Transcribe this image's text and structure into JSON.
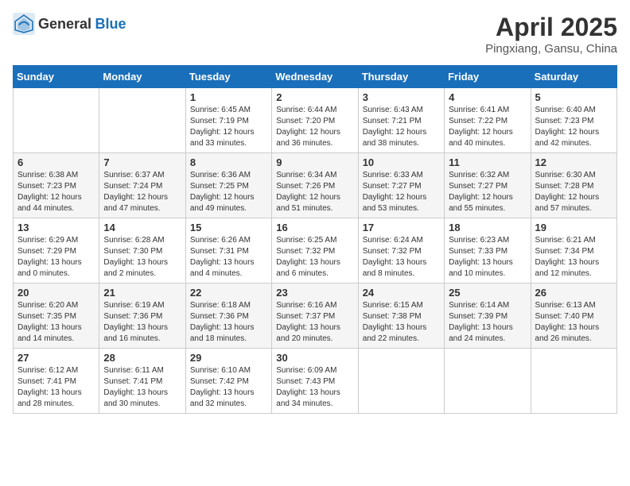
{
  "header": {
    "logo_general": "General",
    "logo_blue": "Blue",
    "month_title": "April 2025",
    "location": "Pingxiang, Gansu, China"
  },
  "days_of_week": [
    "Sunday",
    "Monday",
    "Tuesday",
    "Wednesday",
    "Thursday",
    "Friday",
    "Saturday"
  ],
  "weeks": [
    [
      {
        "day": "",
        "sunrise": "",
        "sunset": "",
        "daylight": ""
      },
      {
        "day": "",
        "sunrise": "",
        "sunset": "",
        "daylight": ""
      },
      {
        "day": "1",
        "sunrise": "Sunrise: 6:45 AM",
        "sunset": "Sunset: 7:19 PM",
        "daylight": "Daylight: 12 hours and 33 minutes."
      },
      {
        "day": "2",
        "sunrise": "Sunrise: 6:44 AM",
        "sunset": "Sunset: 7:20 PM",
        "daylight": "Daylight: 12 hours and 36 minutes."
      },
      {
        "day": "3",
        "sunrise": "Sunrise: 6:43 AM",
        "sunset": "Sunset: 7:21 PM",
        "daylight": "Daylight: 12 hours and 38 minutes."
      },
      {
        "day": "4",
        "sunrise": "Sunrise: 6:41 AM",
        "sunset": "Sunset: 7:22 PM",
        "daylight": "Daylight: 12 hours and 40 minutes."
      },
      {
        "day": "5",
        "sunrise": "Sunrise: 6:40 AM",
        "sunset": "Sunset: 7:23 PM",
        "daylight": "Daylight: 12 hours and 42 minutes."
      }
    ],
    [
      {
        "day": "6",
        "sunrise": "Sunrise: 6:38 AM",
        "sunset": "Sunset: 7:23 PM",
        "daylight": "Daylight: 12 hours and 44 minutes."
      },
      {
        "day": "7",
        "sunrise": "Sunrise: 6:37 AM",
        "sunset": "Sunset: 7:24 PM",
        "daylight": "Daylight: 12 hours and 47 minutes."
      },
      {
        "day": "8",
        "sunrise": "Sunrise: 6:36 AM",
        "sunset": "Sunset: 7:25 PM",
        "daylight": "Daylight: 12 hours and 49 minutes."
      },
      {
        "day": "9",
        "sunrise": "Sunrise: 6:34 AM",
        "sunset": "Sunset: 7:26 PM",
        "daylight": "Daylight: 12 hours and 51 minutes."
      },
      {
        "day": "10",
        "sunrise": "Sunrise: 6:33 AM",
        "sunset": "Sunset: 7:27 PM",
        "daylight": "Daylight: 12 hours and 53 minutes."
      },
      {
        "day": "11",
        "sunrise": "Sunrise: 6:32 AM",
        "sunset": "Sunset: 7:27 PM",
        "daylight": "Daylight: 12 hours and 55 minutes."
      },
      {
        "day": "12",
        "sunrise": "Sunrise: 6:30 AM",
        "sunset": "Sunset: 7:28 PM",
        "daylight": "Daylight: 12 hours and 57 minutes."
      }
    ],
    [
      {
        "day": "13",
        "sunrise": "Sunrise: 6:29 AM",
        "sunset": "Sunset: 7:29 PM",
        "daylight": "Daylight: 13 hours and 0 minutes."
      },
      {
        "day": "14",
        "sunrise": "Sunrise: 6:28 AM",
        "sunset": "Sunset: 7:30 PM",
        "daylight": "Daylight: 13 hours and 2 minutes."
      },
      {
        "day": "15",
        "sunrise": "Sunrise: 6:26 AM",
        "sunset": "Sunset: 7:31 PM",
        "daylight": "Daylight: 13 hours and 4 minutes."
      },
      {
        "day": "16",
        "sunrise": "Sunrise: 6:25 AM",
        "sunset": "Sunset: 7:32 PM",
        "daylight": "Daylight: 13 hours and 6 minutes."
      },
      {
        "day": "17",
        "sunrise": "Sunrise: 6:24 AM",
        "sunset": "Sunset: 7:32 PM",
        "daylight": "Daylight: 13 hours and 8 minutes."
      },
      {
        "day": "18",
        "sunrise": "Sunrise: 6:23 AM",
        "sunset": "Sunset: 7:33 PM",
        "daylight": "Daylight: 13 hours and 10 minutes."
      },
      {
        "day": "19",
        "sunrise": "Sunrise: 6:21 AM",
        "sunset": "Sunset: 7:34 PM",
        "daylight": "Daylight: 13 hours and 12 minutes."
      }
    ],
    [
      {
        "day": "20",
        "sunrise": "Sunrise: 6:20 AM",
        "sunset": "Sunset: 7:35 PM",
        "daylight": "Daylight: 13 hours and 14 minutes."
      },
      {
        "day": "21",
        "sunrise": "Sunrise: 6:19 AM",
        "sunset": "Sunset: 7:36 PM",
        "daylight": "Daylight: 13 hours and 16 minutes."
      },
      {
        "day": "22",
        "sunrise": "Sunrise: 6:18 AM",
        "sunset": "Sunset: 7:36 PM",
        "daylight": "Daylight: 13 hours and 18 minutes."
      },
      {
        "day": "23",
        "sunrise": "Sunrise: 6:16 AM",
        "sunset": "Sunset: 7:37 PM",
        "daylight": "Daylight: 13 hours and 20 minutes."
      },
      {
        "day": "24",
        "sunrise": "Sunrise: 6:15 AM",
        "sunset": "Sunset: 7:38 PM",
        "daylight": "Daylight: 13 hours and 22 minutes."
      },
      {
        "day": "25",
        "sunrise": "Sunrise: 6:14 AM",
        "sunset": "Sunset: 7:39 PM",
        "daylight": "Daylight: 13 hours and 24 minutes."
      },
      {
        "day": "26",
        "sunrise": "Sunrise: 6:13 AM",
        "sunset": "Sunset: 7:40 PM",
        "daylight": "Daylight: 13 hours and 26 minutes."
      }
    ],
    [
      {
        "day": "27",
        "sunrise": "Sunrise: 6:12 AM",
        "sunset": "Sunset: 7:41 PM",
        "daylight": "Daylight: 13 hours and 28 minutes."
      },
      {
        "day": "28",
        "sunrise": "Sunrise: 6:11 AM",
        "sunset": "Sunset: 7:41 PM",
        "daylight": "Daylight: 13 hours and 30 minutes."
      },
      {
        "day": "29",
        "sunrise": "Sunrise: 6:10 AM",
        "sunset": "Sunset: 7:42 PM",
        "daylight": "Daylight: 13 hours and 32 minutes."
      },
      {
        "day": "30",
        "sunrise": "Sunrise: 6:09 AM",
        "sunset": "Sunset: 7:43 PM",
        "daylight": "Daylight: 13 hours and 34 minutes."
      },
      {
        "day": "",
        "sunrise": "",
        "sunset": "",
        "daylight": ""
      },
      {
        "day": "",
        "sunrise": "",
        "sunset": "",
        "daylight": ""
      },
      {
        "day": "",
        "sunrise": "",
        "sunset": "",
        "daylight": ""
      }
    ]
  ]
}
